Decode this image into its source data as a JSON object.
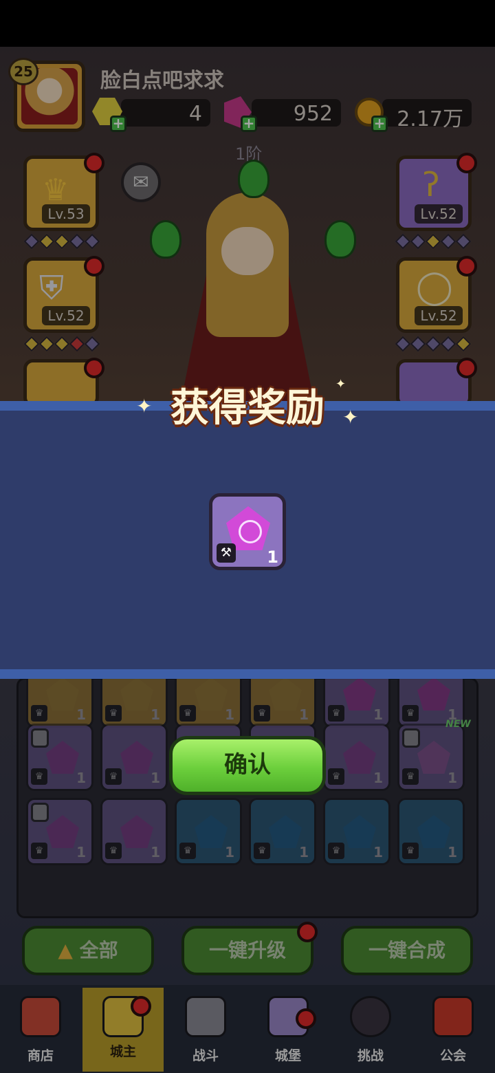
{
  "player": {
    "level": "25",
    "name": "脸白点吧求求"
  },
  "currencies": [
    {
      "name": "energy",
      "value": "4",
      "color": "#e0d040"
    },
    {
      "name": "gem",
      "value": "952",
      "color": "#c63a8a"
    },
    {
      "name": "gold",
      "value": "2.17万",
      "color": "#e0a020"
    }
  ],
  "rank_label": "1阶",
  "equipment_left": [
    {
      "icon": "crown-icon",
      "level": "Lv.53"
    },
    {
      "icon": "armor-icon",
      "level": "Lv.52"
    }
  ],
  "equipment_right": [
    {
      "icon": "staff-icon",
      "level": "Lv.52"
    },
    {
      "icon": "ring-icon",
      "level": "Lv.52"
    }
  ],
  "modal": {
    "title": "获得奖励",
    "reward": {
      "icon": "purple-gem-icon",
      "tag_icon": "staff-tag-icon",
      "count": "1"
    },
    "confirm_label": "确认"
  },
  "inventory": {
    "new_tag": "NEW",
    "counts": [
      "1",
      "1",
      "1",
      "1",
      "1",
      "1",
      "1",
      "1",
      "1",
      "1",
      "1",
      "1",
      "1",
      "1",
      "1",
      "1",
      "1",
      "1"
    ]
  },
  "actions": {
    "all_label": "全部",
    "upgrade_label": "一键升级",
    "merge_label": "一键合成"
  },
  "tabs": [
    {
      "label": "商店",
      "icon": "shop-icon"
    },
    {
      "label": "城主",
      "icon": "lord-icon"
    },
    {
      "label": "战斗",
      "icon": "swords-icon"
    },
    {
      "label": "城堡",
      "icon": "castle-icon"
    },
    {
      "label": "挑战",
      "icon": "demon-icon"
    },
    {
      "label": "公会",
      "icon": "guild-banner-icon"
    }
  ]
}
